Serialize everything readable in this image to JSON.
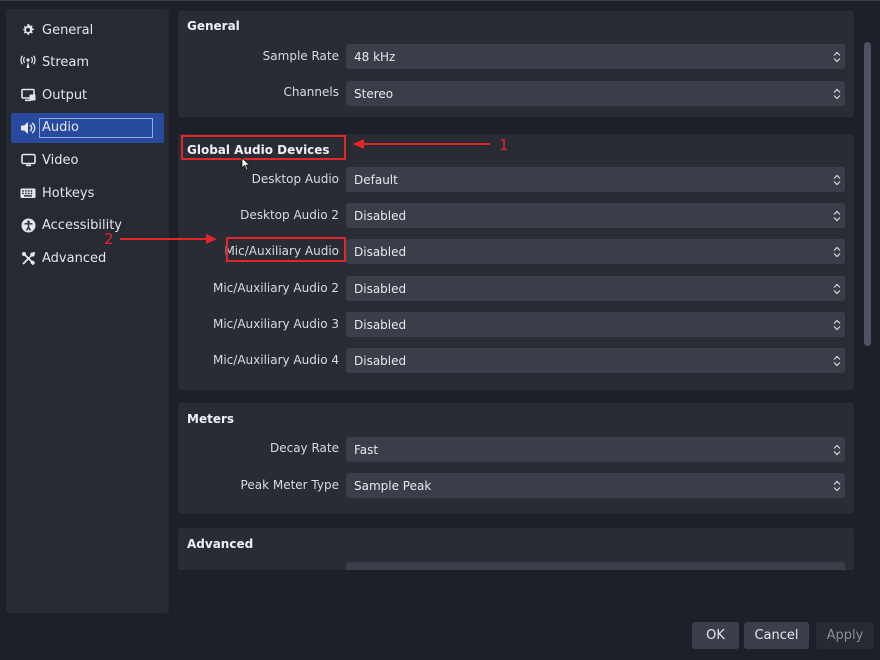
{
  "sidebar": {
    "items": [
      {
        "label": "General",
        "icon": "gear-icon"
      },
      {
        "label": "Stream",
        "icon": "antenna-icon"
      },
      {
        "label": "Output",
        "icon": "output-icon"
      },
      {
        "label": "Audio",
        "icon": "speaker-icon",
        "active": true
      },
      {
        "label": "Video",
        "icon": "monitor-icon"
      },
      {
        "label": "Hotkeys",
        "icon": "keyboard-icon"
      },
      {
        "label": "Accessibility",
        "icon": "accessibility-icon"
      },
      {
        "label": "Advanced",
        "icon": "tools-icon"
      }
    ]
  },
  "general": {
    "title": "General",
    "sample_rate": {
      "label": "Sample Rate",
      "value": "48 kHz"
    },
    "channels": {
      "label": "Channels",
      "value": "Stereo"
    }
  },
  "devices": {
    "title": "Global Audio Devices",
    "rows": [
      {
        "label": "Desktop Audio",
        "value": "Default"
      },
      {
        "label": "Desktop Audio 2",
        "value": "Disabled"
      },
      {
        "label": "Mic/Auxiliary Audio",
        "value": "Disabled"
      },
      {
        "label": "Mic/Auxiliary Audio 2",
        "value": "Disabled"
      },
      {
        "label": "Mic/Auxiliary Audio 3",
        "value": "Disabled"
      },
      {
        "label": "Mic/Auxiliary Audio 4",
        "value": "Disabled"
      }
    ]
  },
  "meters": {
    "title": "Meters",
    "decay_rate": {
      "label": "Decay Rate",
      "value": "Fast"
    },
    "peak_meter_type": {
      "label": "Peak Meter Type",
      "value": "Sample Peak"
    }
  },
  "advanced": {
    "title": "Advanced"
  },
  "buttons": {
    "ok": "OK",
    "cancel": "Cancel",
    "apply": "Apply"
  },
  "annotations": {
    "one": "1",
    "two": "2",
    "color": "#e3262c"
  },
  "colors": {
    "accent": "#284a9e",
    "background": "#1e2029",
    "panel": "#292c35"
  }
}
